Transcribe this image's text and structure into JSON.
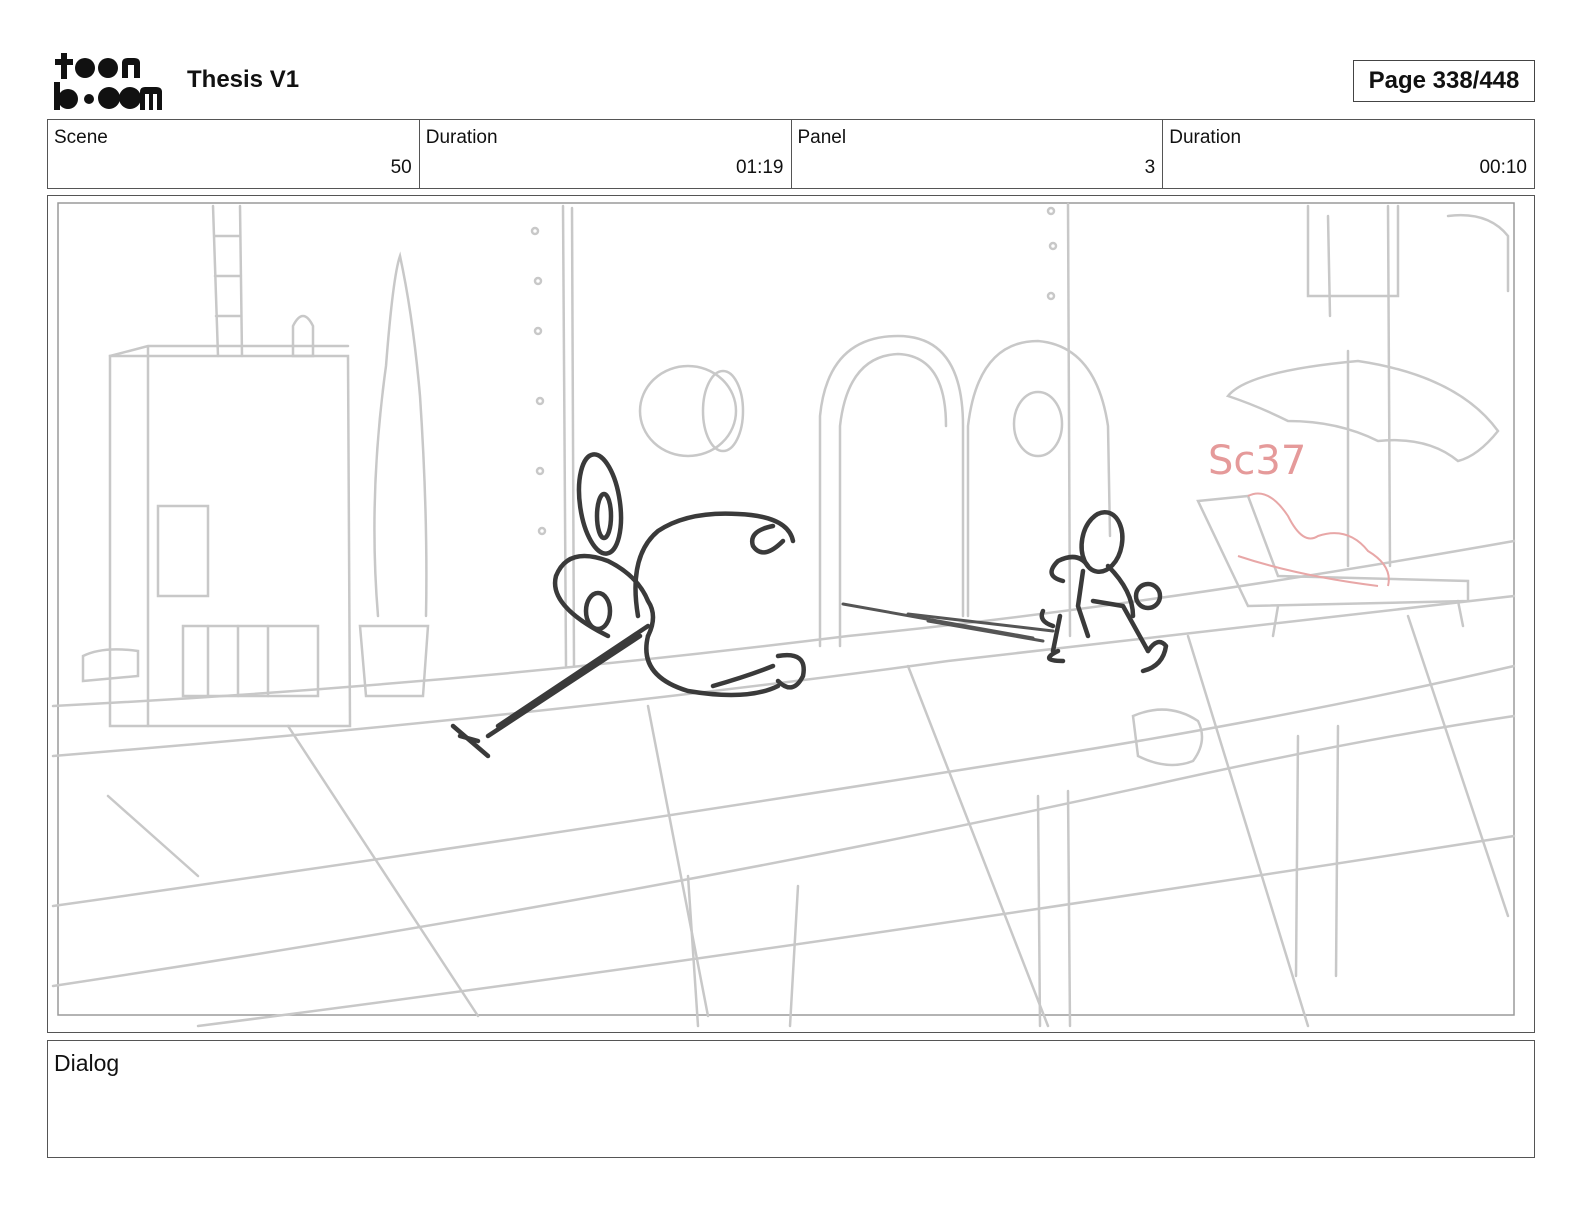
{
  "header": {
    "logo_name": "toon-boom-logo",
    "project_title": "Thesis V1",
    "page_indicator": "Page 338/448"
  },
  "info": {
    "scene_label": "Scene",
    "scene_value": "50",
    "scene_duration_label": "Duration",
    "scene_duration_value": "01:19",
    "panel_label": "Panel",
    "panel_value": "3",
    "panel_duration_label": "Duration",
    "panel_duration_value": "00:10"
  },
  "panel": {
    "sketch_note": "Sc37",
    "note_color": "#e59a9a",
    "background_line_color": "#c8c8c8",
    "character_line_color": "#3a3a3a"
  },
  "dialog": {
    "label": "Dialog",
    "text": ""
  }
}
